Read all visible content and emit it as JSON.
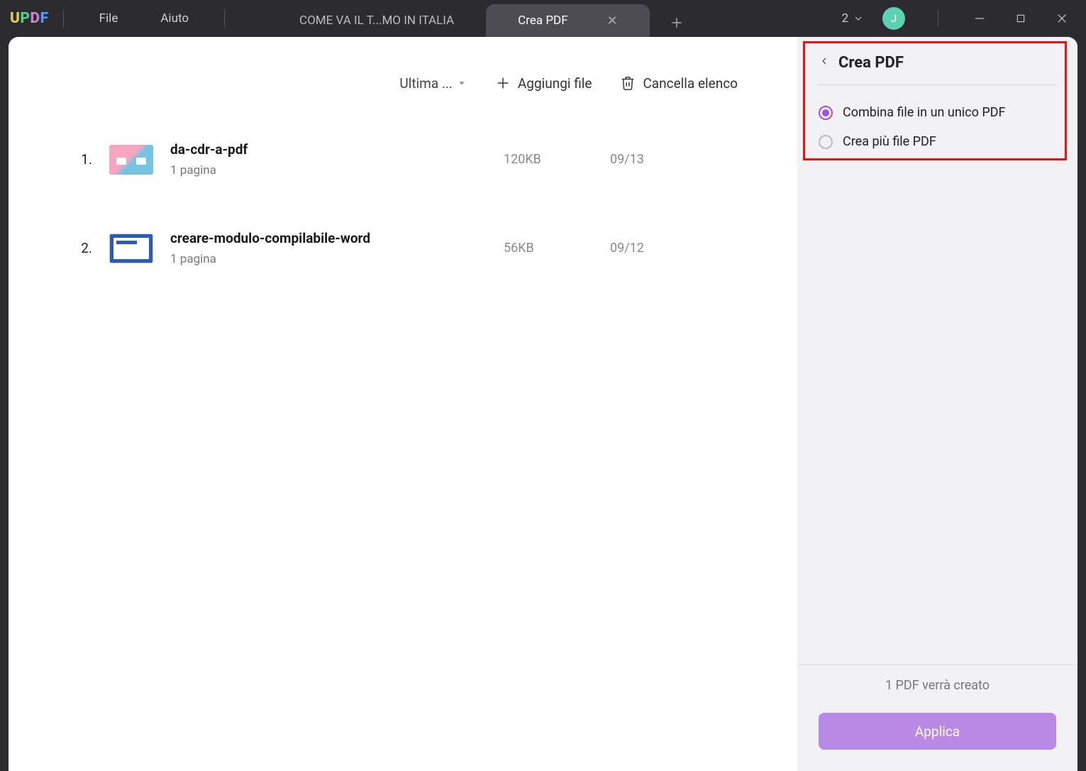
{
  "titlebar": {
    "menu_file": "File",
    "menu_help": "Aiuto",
    "tab1": "COME VA IL T...MO IN ITALIA",
    "tab2": "Crea PDF",
    "window_count": "2",
    "avatar": "J"
  },
  "toolbar": {
    "sort_label": "Ultima ...",
    "add_file": "Aggiungi file",
    "clear_list": "Cancella elenco"
  },
  "files": [
    {
      "idx": "1.",
      "name": "da-cdr-a-pdf",
      "pages": "1 pagina",
      "size": "120KB",
      "date": "09/13"
    },
    {
      "idx": "2.",
      "name": "creare-modulo-compilabile-word",
      "pages": "1 pagina",
      "size": "56KB",
      "date": "09/12"
    }
  ],
  "side": {
    "title": "Crea PDF",
    "opt_combine": "Combina file in un unico PDF",
    "opt_multi": "Crea più file PDF",
    "status": "1 PDF verrà creato",
    "apply": "Applica"
  }
}
